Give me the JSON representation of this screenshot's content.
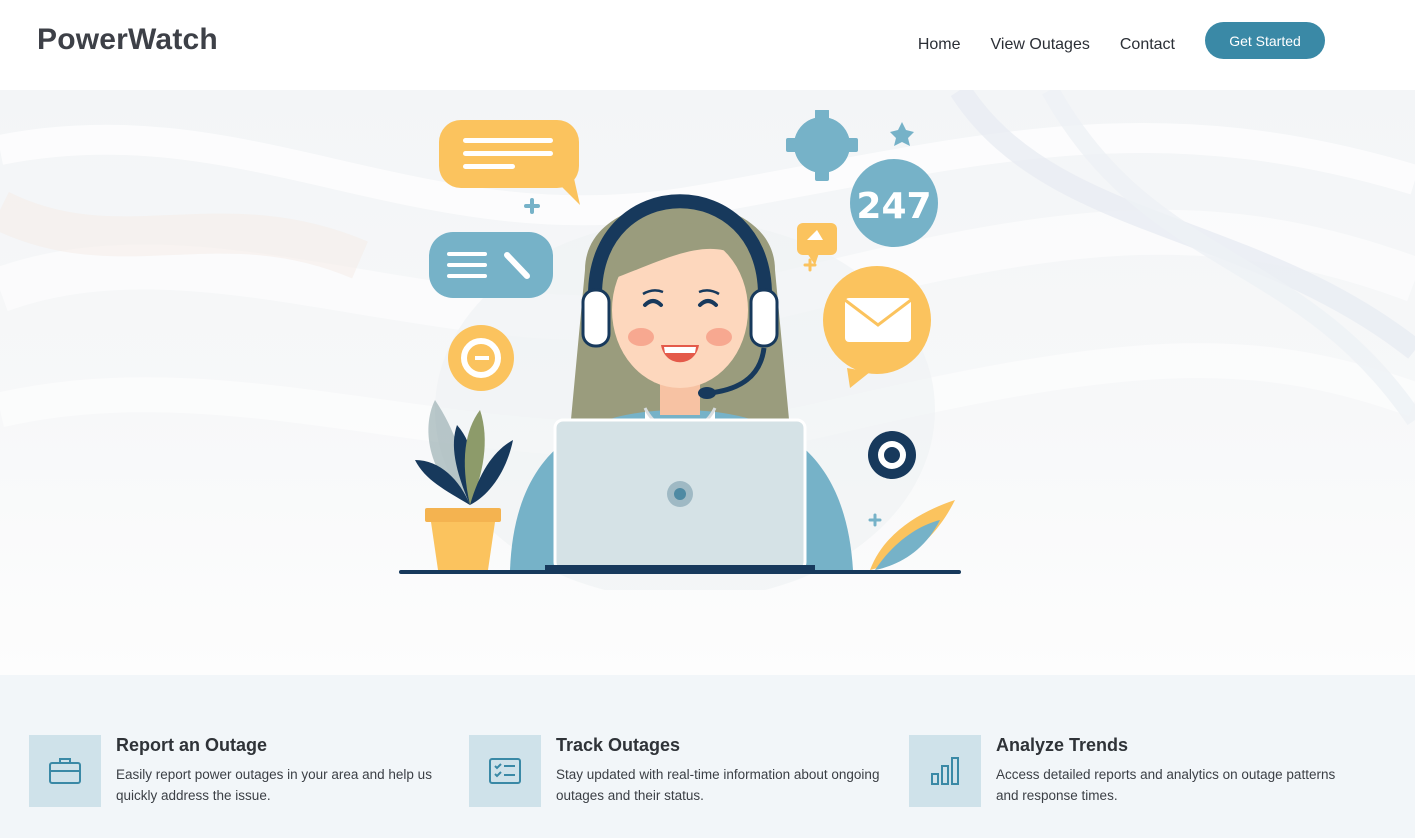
{
  "header": {
    "logo": "PowerWatch",
    "nav": [
      {
        "label": "Home"
      },
      {
        "label": "View Outages"
      },
      {
        "label": "Contact"
      }
    ],
    "cta_label": "Get Started"
  },
  "hero": {
    "badge_text": "247"
  },
  "features": [
    {
      "icon": "briefcase-icon",
      "title": "Report an Outage",
      "description": "Easily report power outages in your area and help us quickly address the issue."
    },
    {
      "icon": "checklist-icon",
      "title": "Track Outages",
      "description": "Stay updated with real-time information about ongoing outages and their status."
    },
    {
      "icon": "bar-chart-icon",
      "title": "Analyze Trends",
      "description": "Access detailed reports and analytics on outage patterns and response times."
    }
  ],
  "colors": {
    "accent": "#3a89a6",
    "icon_tile": "#cfe2ea",
    "feature_bg": "#f2f6f9",
    "logo_text": "#3d4047"
  }
}
